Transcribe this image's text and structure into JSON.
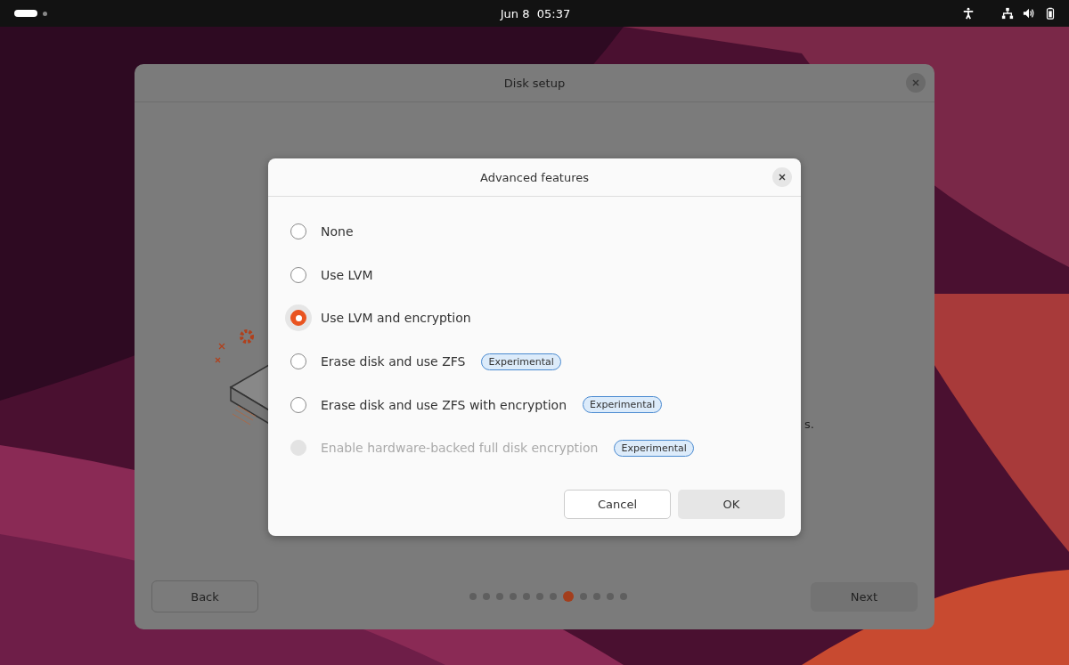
{
  "top_bar": {
    "clock": "Jun 8  05:37",
    "workspaces": [
      {
        "selected": true
      },
      {
        "selected": false
      }
    ]
  },
  "window": {
    "title": "Disk setup",
    "partial_text": "s.",
    "back_button": "Back",
    "next_button": "Next",
    "pager": [
      {
        "selected": false
      },
      {
        "selected": false
      },
      {
        "selected": false
      },
      {
        "selected": false
      },
      {
        "selected": false
      },
      {
        "selected": false
      },
      {
        "selected": false
      },
      {
        "selected": true
      },
      {
        "selected": false
      },
      {
        "selected": false
      },
      {
        "selected": false
      },
      {
        "selected": false
      }
    ]
  },
  "dialog": {
    "title": "Advanced features",
    "options": [
      {
        "label": "None",
        "selected": false,
        "disabled": false
      },
      {
        "label": "Use LVM",
        "selected": false,
        "disabled": false
      },
      {
        "label": "Use LVM and encryption",
        "selected": true,
        "disabled": false
      },
      {
        "label": "Erase disk and use ZFS",
        "selected": false,
        "disabled": false,
        "badge": "Experimental"
      },
      {
        "label": "Erase disk and use ZFS with encryption",
        "selected": false,
        "disabled": false,
        "badge": "Experimental"
      },
      {
        "label": "Enable hardware-backed full disk encryption",
        "selected": false,
        "disabled": true,
        "badge": "Experimental"
      }
    ],
    "buttons": [
      {
        "label": "Cancel",
        "kind": "secondary"
      },
      {
        "label": "OK",
        "kind": "primary"
      }
    ]
  }
}
